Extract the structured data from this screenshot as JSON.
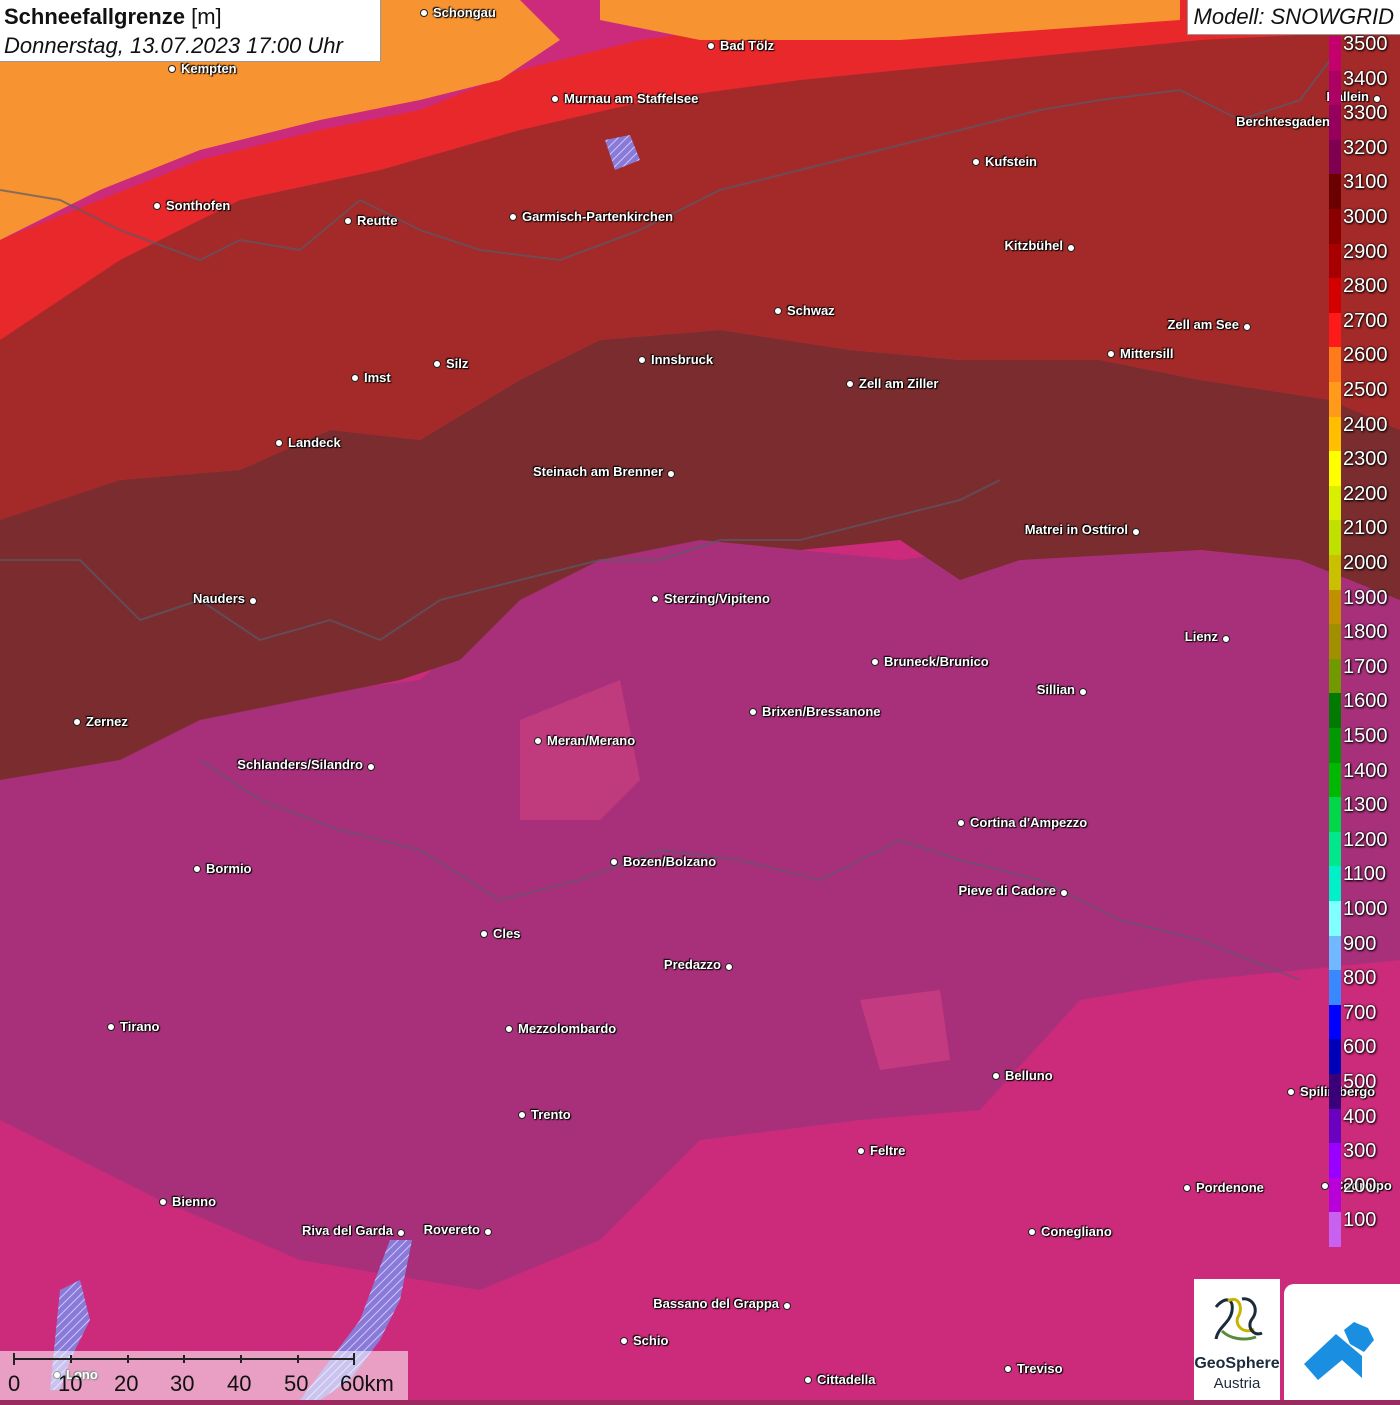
{
  "header": {
    "title_bold": "Schneefallgrenze",
    "title_unit": "[m]",
    "datetime": "Donnerstag, 13.07.2023 17:00 Uhr",
    "model": "Modell: SNOWGRID"
  },
  "legend": {
    "levels": [
      {
        "label": "3500",
        "color": "#c4006e"
      },
      {
        "label": "3400",
        "color": "#ad0065"
      },
      {
        "label": "3300",
        "color": "#96005d"
      },
      {
        "label": "3200",
        "color": "#7f0050"
      },
      {
        "label": "3100",
        "color": "#6b0000"
      },
      {
        "label": "3000",
        "color": "#8a0000"
      },
      {
        "label": "2900",
        "color": "#a80000"
      },
      {
        "label": "2800",
        "color": "#d40000"
      },
      {
        "label": "2700",
        "color": "#ff1a1a"
      },
      {
        "label": "2600",
        "color": "#ff7a1a"
      },
      {
        "label": "2500",
        "color": "#ff9a1a"
      },
      {
        "label": "2400",
        "color": "#ffbf00"
      },
      {
        "label": "2300",
        "color": "#ffff00"
      },
      {
        "label": "2200",
        "color": "#d8f000"
      },
      {
        "label": "2100",
        "color": "#c0e000"
      },
      {
        "label": "2000",
        "color": "#c8c000"
      },
      {
        "label": "1900",
        "color": "#c09000"
      },
      {
        "label": "1800",
        "color": "#a09000"
      },
      {
        "label": "1700",
        "color": "#709a00"
      },
      {
        "label": "1600",
        "color": "#007a00"
      },
      {
        "label": "1500",
        "color": "#009a00"
      },
      {
        "label": "1400",
        "color": "#00b800"
      },
      {
        "label": "1300",
        "color": "#00d84a"
      },
      {
        "label": "1200",
        "color": "#00e88a"
      },
      {
        "label": "1100",
        "color": "#00f0c8"
      },
      {
        "label": "1000",
        "color": "#80ffff"
      },
      {
        "label": "900",
        "color": "#70b8ff"
      },
      {
        "label": "800",
        "color": "#3a88ff"
      },
      {
        "label": "700",
        "color": "#0000ff"
      },
      {
        "label": "600",
        "color": "#0000b8"
      },
      {
        "label": "500",
        "color": "#3a007a"
      },
      {
        "label": "400",
        "color": "#6a00c0"
      },
      {
        "label": "300",
        "color": "#9a00ff"
      },
      {
        "label": "200",
        "color": "#b800d8"
      },
      {
        "label": "100",
        "color": "#c860f0"
      }
    ]
  },
  "cities": [
    {
      "name": "Schongau",
      "label": "Schongau"
    },
    {
      "name": "Bad Tölz",
      "label": "Bad Tölz"
    },
    {
      "name": "Kempten",
      "label": "Kempten"
    },
    {
      "name": "Murnau",
      "label": "Murnau am Staffelsee"
    },
    {
      "name": "Hallein",
      "label": "Hallein"
    },
    {
      "name": "Berchtesgaden",
      "label": "Berchtesgaden"
    },
    {
      "name": "Kufstein",
      "label": "Kufstein"
    },
    {
      "name": "Sonthofen",
      "label": "Sonthofen"
    },
    {
      "name": "Reutte",
      "label": "Reutte"
    },
    {
      "name": "Garmisch",
      "label": "Garmisch-Partenkirchen"
    },
    {
      "name": "Kitzbühel",
      "label": "Kitzbühel"
    },
    {
      "name": "Schwaz",
      "label": "Schwaz"
    },
    {
      "name": "Zell am See",
      "label": "Zell am See"
    },
    {
      "name": "Mittersill",
      "label": "Mittersill"
    },
    {
      "name": "Innsbruck",
      "label": "Innsbruck"
    },
    {
      "name": "Silz",
      "label": "Silz"
    },
    {
      "name": "Imst",
      "label": "Imst"
    },
    {
      "name": "Zell am Ziller",
      "label": "Zell am Ziller"
    },
    {
      "name": "Landeck",
      "label": "Landeck"
    },
    {
      "name": "Steinach",
      "label": "Steinach am Brenner"
    },
    {
      "name": "Matrei",
      "label": "Matrei in Osttirol"
    },
    {
      "name": "Nauders",
      "label": "Nauders"
    },
    {
      "name": "Sterzing",
      "label": "Sterzing/Vipiteno"
    },
    {
      "name": "Lienz",
      "label": "Lienz"
    },
    {
      "name": "Bruneck",
      "label": "Bruneck/Brunico"
    },
    {
      "name": "Sillian",
      "label": "Sillian"
    },
    {
      "name": "Zernez",
      "label": "Zernez"
    },
    {
      "name": "Brixen",
      "label": "Brixen/Bressanone"
    },
    {
      "name": "Meran",
      "label": "Meran/Merano"
    },
    {
      "name": "Schlanders",
      "label": "Schlanders/Silandro"
    },
    {
      "name": "Cortina",
      "label": "Cortina d'Ampezzo"
    },
    {
      "name": "Bozen",
      "label": "Bozen/Bolzano"
    },
    {
      "name": "Bormio",
      "label": "Bormio"
    },
    {
      "name": "Pieve di Cadore",
      "label": "Pieve di Cadore"
    },
    {
      "name": "Cles",
      "label": "Cles"
    },
    {
      "name": "Predazzo",
      "label": "Predazzo"
    },
    {
      "name": "Tirano",
      "label": "Tirano"
    },
    {
      "name": "Mezzolombardo",
      "label": "Mezzolombardo"
    },
    {
      "name": "Belluno",
      "label": "Belluno"
    },
    {
      "name": "Spilimbergo",
      "label": "Spilimbergo"
    },
    {
      "name": "Trento",
      "label": "Trento"
    },
    {
      "name": "Feltre",
      "label": "Feltre"
    },
    {
      "name": "Pordenone",
      "label": "Pordenone"
    },
    {
      "name": "Codroipo",
      "label": "Codroipo"
    },
    {
      "name": "Bienno",
      "label": "Bienno"
    },
    {
      "name": "Riva del Garda",
      "label": "Riva del Garda"
    },
    {
      "name": "Rovereto",
      "label": "Rovereto"
    },
    {
      "name": "Conegliano",
      "label": "Conegliano"
    },
    {
      "name": "Bassano",
      "label": "Bassano del Grappa"
    },
    {
      "name": "Schio",
      "label": "Schio"
    },
    {
      "name": "Lonato",
      "label": "Lono"
    },
    {
      "name": "Treviso",
      "label": "Treviso"
    },
    {
      "name": "Cittadella",
      "label": "Cittadella"
    }
  ],
  "scalebar": {
    "ticks": [
      "0",
      "10",
      "20",
      "30",
      "40",
      "50",
      "60km"
    ]
  },
  "logo": {
    "line1": "GeoSphere",
    "line2": "Austria"
  }
}
